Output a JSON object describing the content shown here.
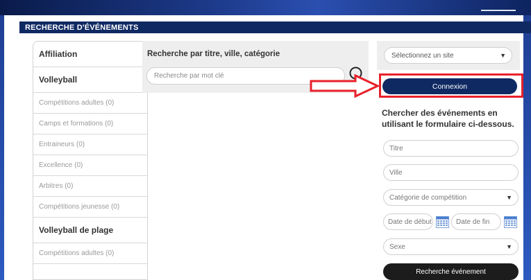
{
  "header": {
    "title": "RECHERCHE D'ÉVÉNEMENTS"
  },
  "sidebar": {
    "items": [
      {
        "label": "Affiliation",
        "type": "head"
      },
      {
        "label": "Volleyball",
        "type": "head"
      },
      {
        "label": "Compétitions adultes (0)",
        "type": "item"
      },
      {
        "label": "Camps et formations (0)",
        "type": "item"
      },
      {
        "label": "Entraineurs (0)",
        "type": "item"
      },
      {
        "label": "Excellence (0)",
        "type": "item"
      },
      {
        "label": "Arbitres (0)",
        "type": "item"
      },
      {
        "label": "Compétitions jeunesse (0)",
        "type": "item"
      },
      {
        "label": "Volleyball de plage",
        "type": "head"
      },
      {
        "label": "Compétitions adultes (0)",
        "type": "item"
      }
    ]
  },
  "search": {
    "title": "Recherche par titre, ville, catégorie",
    "placeholder": "Recherche par mot clé"
  },
  "site_selector": {
    "value": "Sélectionnez un site"
  },
  "connect_button": {
    "label": "Connexion"
  },
  "form": {
    "title": "Chercher des événements en utilisant le formulaire ci-dessous.",
    "titre_placeholder": "Titre",
    "ville_placeholder": "Ville",
    "category_value": "Catégorie de compétition",
    "date_start_placeholder": "Date de début",
    "date_end_placeholder": "Date de fin",
    "sexe_value": "Sexe",
    "submit_label": "Recherche événement"
  },
  "colors": {
    "header": "#0f2963",
    "accent_frame": "#e8202a",
    "connect": "#0f2963",
    "submit": "#1c1c1c"
  }
}
